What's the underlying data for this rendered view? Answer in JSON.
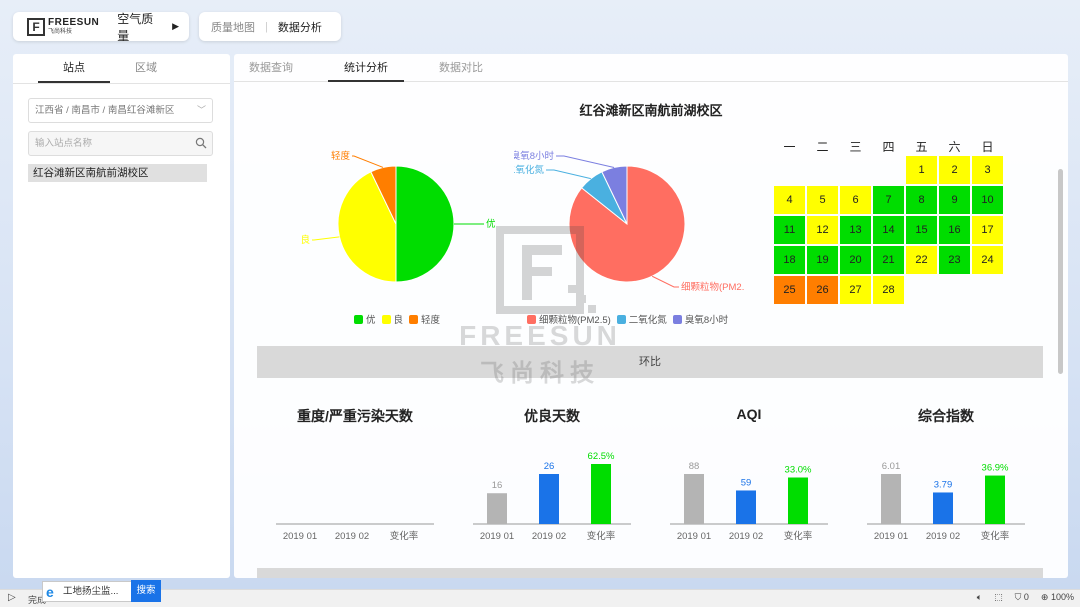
{
  "app": {
    "logo_text": "FREESUN",
    "logo_sub": "飞尚科技",
    "logo_letter": "F",
    "module": "空气质量",
    "nav": [
      "质量地图",
      "数据分析"
    ]
  },
  "left": {
    "tabs": [
      "站点",
      "区域"
    ],
    "region_select": "江西省 / 南昌市 / 南昌红谷滩新区",
    "search_placeholder": "输入站点名称",
    "site": "红谷滩新区南航前湖校区"
  },
  "main": {
    "tabs": [
      "数据查询",
      "统计分析",
      "数据对比"
    ],
    "title": "红谷滩新区南航前湖校区",
    "band_label": "环比"
  },
  "colors": {
    "green": "#00dd00",
    "yellow": "#ffff00",
    "orange": "#ff7e00",
    "salmon": "#ff6e61",
    "sky": "#4ab0e0",
    "purple": "#7b7fe0",
    "gray_bar": "#b4b4b4",
    "blue_bar": "#1a73e8",
    "green_bar": "#00dd00"
  },
  "chart_data": [
    {
      "type": "pie",
      "labels": [
        "优",
        "良",
        "轻度"
      ],
      "values": [
        14,
        12,
        2
      ],
      "legend": [
        "优",
        "良",
        "轻度"
      ],
      "legend_position": "bottom"
    },
    {
      "type": "pie",
      "labels": [
        "细颗粒物(PM2.5)",
        "二氧化氮",
        "臭氧8小时"
      ],
      "slice_labels": [
        "细颗粒物(PM2.",
        "二氧化氮",
        "臭氧8小时"
      ],
      "values": [
        24,
        2,
        2
      ],
      "legend": [
        "细颗粒物(PM2.5)",
        "二氧化氮",
        "臭氧8小时"
      ],
      "legend_position": "bottom"
    },
    {
      "type": "heatmap",
      "weekdays": [
        "一",
        "二",
        "三",
        "四",
        "五",
        "六",
        "日"
      ],
      "start_weekday_index": 4,
      "days": [
        {
          "d": "1",
          "lvl": "yellow"
        },
        {
          "d": "2",
          "lvl": "yellow"
        },
        {
          "d": "3",
          "lvl": "yellow"
        },
        {
          "d": "4",
          "lvl": "yellow"
        },
        {
          "d": "5",
          "lvl": "yellow"
        },
        {
          "d": "6",
          "lvl": "yellow"
        },
        {
          "d": "7",
          "lvl": "green"
        },
        {
          "d": "8",
          "lvl": "green"
        },
        {
          "d": "9",
          "lvl": "green"
        },
        {
          "d": "10",
          "lvl": "green"
        },
        {
          "d": "11",
          "lvl": "green"
        },
        {
          "d": "12",
          "lvl": "yellow"
        },
        {
          "d": "13",
          "lvl": "green"
        },
        {
          "d": "14",
          "lvl": "green"
        },
        {
          "d": "15",
          "lvl": "green"
        },
        {
          "d": "16",
          "lvl": "green"
        },
        {
          "d": "17",
          "lvl": "yellow"
        },
        {
          "d": "18",
          "lvl": "green"
        },
        {
          "d": "19",
          "lvl": "green"
        },
        {
          "d": "20",
          "lvl": "green"
        },
        {
          "d": "21",
          "lvl": "green"
        },
        {
          "d": "22",
          "lvl": "yellow"
        },
        {
          "d": "23",
          "lvl": "green"
        },
        {
          "d": "24",
          "lvl": "yellow"
        },
        {
          "d": "25",
          "lvl": "orange"
        },
        {
          "d": "26",
          "lvl": "orange"
        },
        {
          "d": "27",
          "lvl": "yellow"
        },
        {
          "d": "28",
          "lvl": "yellow"
        }
      ]
    },
    {
      "type": "bar",
      "title": "重度/严重污染天数",
      "categories": [
        "2019 01",
        "2019 02",
        "变化率"
      ],
      "values": [
        0,
        0,
        0
      ],
      "labels": [
        "",
        "",
        ""
      ]
    },
    {
      "type": "bar",
      "title": "优良天数",
      "categories": [
        "2019 01",
        "2019 02",
        "变化率"
      ],
      "values": [
        16,
        26,
        62.5
      ],
      "labels": [
        "16",
        "26",
        "62.5%"
      ]
    },
    {
      "type": "bar",
      "title": "AQI",
      "categories": [
        "2019 01",
        "2019 02",
        "变化率"
      ],
      "values": [
        88,
        59,
        33.0
      ],
      "labels": [
        "88",
        "59",
        "33.0%"
      ]
    },
    {
      "type": "bar",
      "title": "综合指数",
      "categories": [
        "2019 01",
        "2019 02",
        "变化率"
      ],
      "values": [
        6.01,
        3.79,
        36.9
      ],
      "labels": [
        "6.01",
        "3.79",
        "36.9%"
      ]
    }
  ],
  "watermark": {
    "name": "FREESUN",
    "cn": "飞尚科技"
  },
  "status": {
    "done_text": "完成",
    "task_button": "工地扬尘监...",
    "search_button": "搜索",
    "protected_count": "0",
    "zoom": "100%"
  }
}
